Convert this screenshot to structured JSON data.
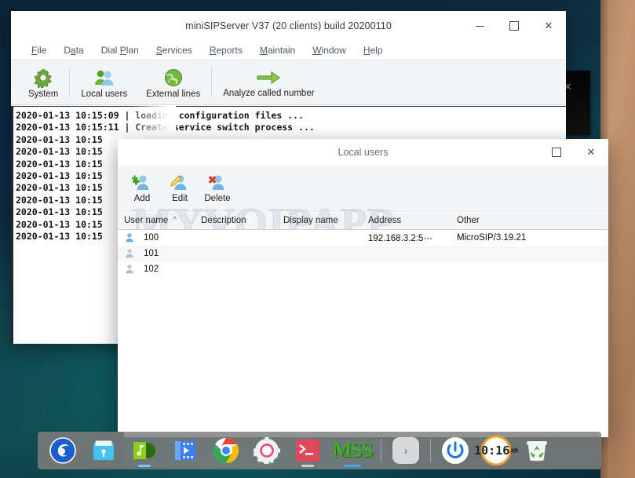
{
  "main_window": {
    "title": "miniSIPServer V37 (20 clients) build 20200110",
    "controls": {
      "minimize": "–",
      "maximize": "□",
      "close": "✕"
    },
    "menu": [
      {
        "label": "File",
        "mnemonic": "F"
      },
      {
        "label": "Data",
        "mnemonic": "a"
      },
      {
        "label": "Dial Plan",
        "mnemonic": "P"
      },
      {
        "label": "Services",
        "mnemonic": "S"
      },
      {
        "label": "Reports",
        "mnemonic": "R"
      },
      {
        "label": "Maintain",
        "mnemonic": "M"
      },
      {
        "label": "Window",
        "mnemonic": "W"
      },
      {
        "label": "Help",
        "mnemonic": "H"
      }
    ],
    "toolbar": [
      {
        "label": "System",
        "icon": "gear-icon"
      },
      {
        "label": "Local users",
        "icon": "users-icon"
      },
      {
        "label": "External lines",
        "icon": "globe-icon"
      },
      {
        "label": "Analyze called number",
        "icon": "arrow-right-icon"
      }
    ],
    "log_lines": [
      "2020-01-13 10:15:09 | loading configuration files ...",
      "2020-01-13 10:15:11 | Create service switch process ...",
      "2020-01-13 10:15",
      "2020-01-13 10:15",
      "2020-01-13 10:15",
      "2020-01-13 10:15",
      "2020-01-13 10:15",
      "2020-01-13 10:15",
      "2020-01-13 10:15",
      "2020-01-13 10:15",
      "2020-01-13 10:15"
    ]
  },
  "users_dialog": {
    "title": "Local users",
    "controls": {
      "maximize": "□",
      "close": "✕"
    },
    "watermark": "MYVOIPAPP",
    "toolbar": [
      {
        "label": "Add",
        "icon": "user-add-icon"
      },
      {
        "label": "Edit",
        "icon": "user-edit-icon"
      },
      {
        "label": "Delete",
        "icon": "user-delete-icon"
      }
    ],
    "table": {
      "columns": [
        "User name",
        "Description",
        "Display name",
        "Address",
        "Other"
      ],
      "sort_column": "User name",
      "sort_indicator": "^",
      "rows": [
        {
          "user": "100",
          "description": "",
          "display_name": "",
          "address": "192.168.3.2:5⋯",
          "other": "MicroSIP/3.19.21",
          "online": true
        },
        {
          "user": "101",
          "description": "",
          "display_name": "",
          "address": "",
          "other": "",
          "online": false
        },
        {
          "user": "102",
          "description": "",
          "display_name": "",
          "address": "",
          "other": "",
          "online": false
        }
      ]
    }
  },
  "black_popup": {
    "close": "✕"
  },
  "taskbar": {
    "items": [
      {
        "name": "deepin-launcher-icon",
        "label": ""
      },
      {
        "name": "file-manager-icon",
        "label": ""
      },
      {
        "name": "music-player-icon",
        "label": ""
      },
      {
        "name": "video-player-icon",
        "label": ""
      },
      {
        "name": "google-chrome-icon",
        "label": ""
      },
      {
        "name": "settings-gear-icon",
        "label": ""
      },
      {
        "name": "terminal-icon",
        "label": ""
      },
      {
        "name": "minisipserver-mss-icon",
        "label": "MSS"
      }
    ],
    "tray_expand": "›",
    "power_icon": "power-icon",
    "clock": {
      "time": "10:16",
      "meridiem": "AM"
    },
    "trash_icon": "trash-recycle-icon"
  },
  "colors": {
    "accent_orange": "#ef7b3d",
    "green_icon": "#6aa84f",
    "desktop_teal": "#0f4a4e",
    "taskbar_gray": "#808080"
  }
}
